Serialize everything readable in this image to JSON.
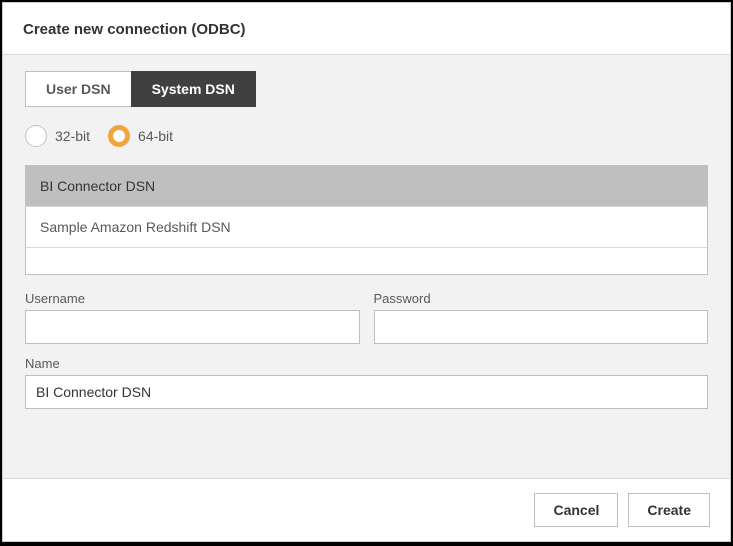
{
  "header": {
    "title": "Create new connection (ODBC)"
  },
  "tabs": {
    "user_dsn": "User DSN",
    "system_dsn": "System DSN",
    "active": "system_dsn"
  },
  "bitness": {
    "opt32": "32-bit",
    "opt64": "64-bit",
    "selected": "64"
  },
  "dsn_list": [
    {
      "label": "BI Connector DSN",
      "selected": true
    },
    {
      "label": "Sample Amazon Redshift DSN",
      "selected": false
    }
  ],
  "fields": {
    "username_label": "Username",
    "username_value": "",
    "password_label": "Password",
    "password_value": "",
    "name_label": "Name",
    "name_value": "BI Connector DSN"
  },
  "footer": {
    "cancel": "Cancel",
    "create": "Create"
  }
}
